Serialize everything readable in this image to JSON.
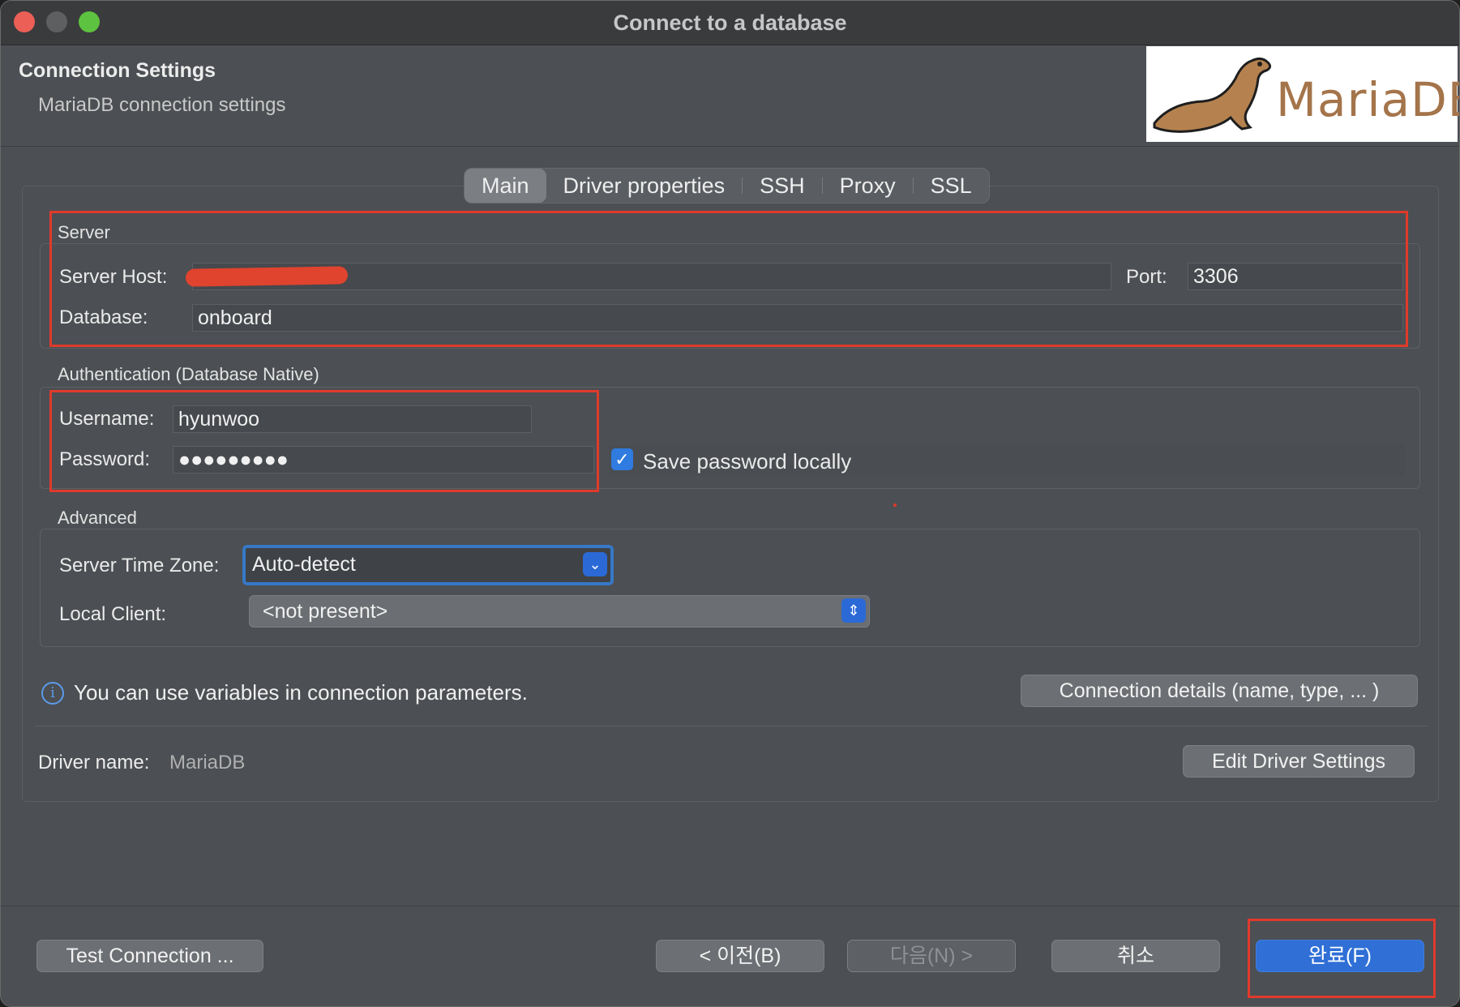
{
  "window": {
    "title": "Connect to a database"
  },
  "header": {
    "title": "Connection Settings",
    "subtitle": "MariaDB connection settings",
    "logo_text": "MariaDB"
  },
  "tabs": [
    {
      "label": "Main",
      "active": true
    },
    {
      "label": "Driver properties",
      "active": false
    },
    {
      "label": "SSH",
      "active": false
    },
    {
      "label": "Proxy",
      "active": false
    },
    {
      "label": "SSL",
      "active": false
    }
  ],
  "server": {
    "group_label": "Server",
    "host_label": "Server Host:",
    "host_value": "",
    "port_label": "Port:",
    "port_value": "3306",
    "database_label": "Database:",
    "database_value": "onboard"
  },
  "auth": {
    "group_label": "Authentication (Database Native)",
    "username_label": "Username:",
    "username_value": "hyunwoo",
    "password_label": "Password:",
    "password_value": "●●●●●●●●●",
    "save_password_label": "Save password locally",
    "save_password_checked": true
  },
  "advanced": {
    "group_label": "Advanced",
    "timezone_label": "Server Time Zone:",
    "timezone_value": "Auto-detect",
    "local_client_label": "Local Client:",
    "local_client_value": "<not present>"
  },
  "info": {
    "text": "You can use variables in connection parameters.",
    "connection_details_button": "Connection details (name, type, ... )"
  },
  "driver": {
    "label": "Driver name:",
    "value": "MariaDB",
    "edit_button": "Edit Driver Settings"
  },
  "footer": {
    "test_button": "Test Connection ...",
    "back_button": "< 이전(B)",
    "next_button": "다음(N) >",
    "cancel_button": "취소",
    "finish_button": "완료(F)"
  },
  "colors": {
    "accent": "#2f6fd6",
    "highlight_annotation": "#e03a2b"
  }
}
